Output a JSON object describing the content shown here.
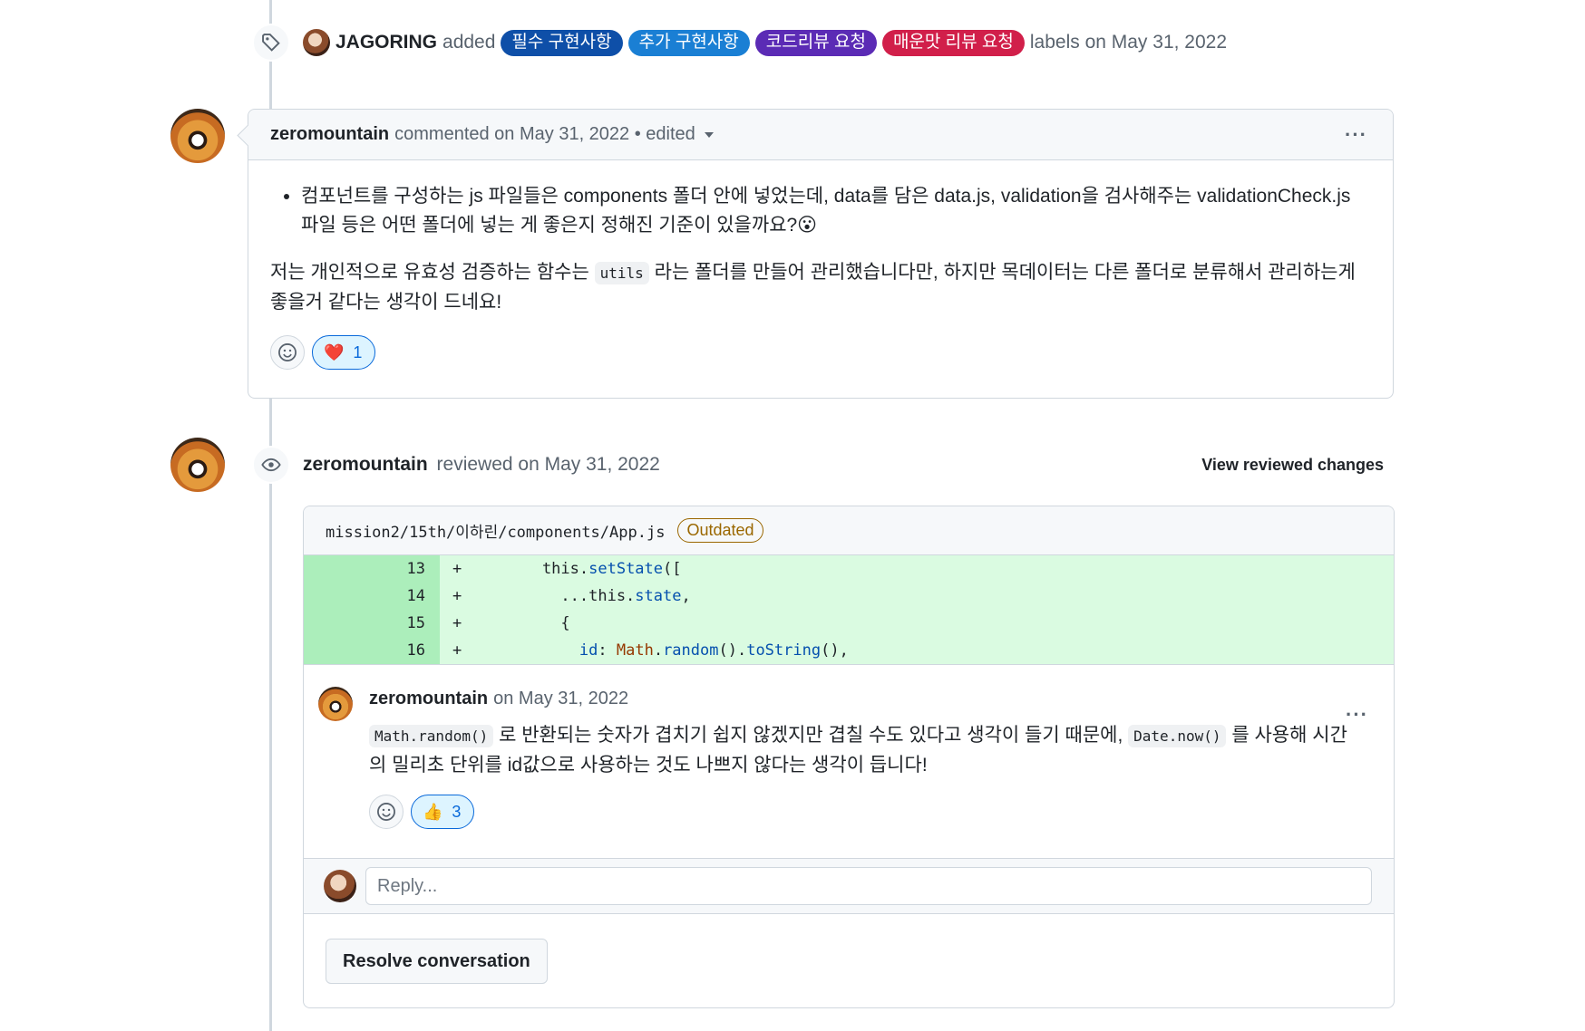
{
  "label_event": {
    "author": "JAGORING",
    "action": "added",
    "labels": [
      {
        "text": "필수 구현사항",
        "color": "#0e4fa8"
      },
      {
        "text": "추가 구현사항",
        "color": "#1a7fd4"
      },
      {
        "text": "코드리뷰 요청",
        "color": "#5b2bb5"
      },
      {
        "text": "매운맛 리뷰 요청",
        "color": "#d11f4a"
      }
    ],
    "suffix": "labels on May 31, 2022"
  },
  "comment": {
    "author": "zeromountain",
    "meta": "commented on May 31, 2022 • edited",
    "bullet": "컴포넌트를 구성하는 js 파일들은 components 폴더 안에 넣었는데, data를 담은 data.js, validation을 검사해주는 validationCheck.js 파일 등은 어떤 폴더에 넣는 게 좋은지 정해진 기준이 있을까요?😮",
    "para_before": "저는 개인적으로 유효성 검증하는 함수는 ",
    "para_code": "utils",
    "para_after": " 라는 폴더를 만들어 관리했습니다만, 하지만 목데이터는 다른 폴더로 분류해서 관리하는게 좋을거 같다는 생각이 드네요!",
    "reaction_emoji": "❤️",
    "reaction_count": "1"
  },
  "review": {
    "author": "zeromountain",
    "meta": "reviewed on May 31, 2022",
    "view_changes": "View reviewed changes",
    "file_path": "mission2/15th/이하린/components/App.js",
    "outdated": "Outdated",
    "diff": [
      {
        "num": "13",
        "sign": "+"
      },
      {
        "num": "14",
        "sign": "+"
      },
      {
        "num": "15",
        "sign": "+"
      },
      {
        "num": "16",
        "sign": "+"
      }
    ],
    "thread": {
      "author": "zeromountain",
      "meta": "on May 31, 2022",
      "code1": "Math.random()",
      "text1": " 로 반환되는 숫자가 겹치기 쉽지 않겠지만 겹칠 수도 있다고 생각이 들기 때문에, ",
      "code2": "Date.now()",
      "text2": " 를 사용해 시간의 밀리초 단위를 id값으로 사용하는 것도 나쁘지 않다는 생각이 듭니다!",
      "reaction_emoji": "👍",
      "reaction_count": "3"
    },
    "reply_placeholder": "Reply...",
    "resolve_label": "Resolve conversation"
  }
}
